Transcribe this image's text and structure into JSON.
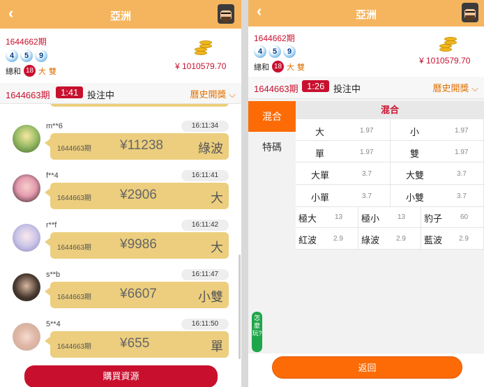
{
  "left": {
    "header": {
      "back_icon": "chevron-left-icon",
      "title": "亞洲",
      "avatar_icon": "user-avatar-icon"
    },
    "draw": {
      "period": "1644662期",
      "balls": [
        "4",
        "5",
        "9"
      ],
      "sum_label": "總和",
      "sum_value": "18",
      "size": "大",
      "parity": "雙",
      "balance": "¥ 1010579.70"
    },
    "current": {
      "period": "1644663期",
      "timer": "1:41",
      "status": "投注中",
      "history": "曆史開獎"
    },
    "messages": [
      {
        "user": "m**6",
        "time": "16:11:34",
        "period": "1644663期",
        "amount": "¥11238",
        "bet": "綠波"
      },
      {
        "user": "f**4",
        "time": "16:11:41",
        "period": "1644663期",
        "amount": "¥2906",
        "bet": "大"
      },
      {
        "user": "r**f",
        "time": "16:11:42",
        "period": "1644663期",
        "amount": "¥9986",
        "bet": "大"
      },
      {
        "user": "s**b",
        "time": "16:11:47",
        "period": "1644663期",
        "amount": "¥6607",
        "bet": "小雙"
      },
      {
        "user": "5**4",
        "time": "16:11:50",
        "period": "1644663期",
        "amount": "¥655",
        "bet": "單"
      }
    ],
    "buy_label": "購買資源"
  },
  "right": {
    "header": {
      "back_icon": "chevron-left-icon",
      "title": "亞洲",
      "avatar_icon": "user-avatar-icon"
    },
    "draw": {
      "period": "1644662期",
      "balls": [
        "4",
        "5",
        "9"
      ],
      "sum_label": "總和",
      "sum_value": "18",
      "size": "大",
      "parity": "雙",
      "balance": "¥ 1010579.70"
    },
    "current": {
      "period": "1644663期",
      "timer": "1:26",
      "status": "投注中",
      "history": "曆史開獎"
    },
    "tabs": [
      "混合",
      "特碼"
    ],
    "section_title": "混合",
    "options_two": [
      {
        "label": "大",
        "odds": "1.97"
      },
      {
        "label": "小",
        "odds": "1.97"
      },
      {
        "label": "單",
        "odds": "1.97"
      },
      {
        "label": "雙",
        "odds": "1.97"
      },
      {
        "label": "大單",
        "odds": "3.7"
      },
      {
        "label": "大雙",
        "odds": "3.7"
      },
      {
        "label": "小單",
        "odds": "3.7"
      },
      {
        "label": "小雙",
        "odds": "3.7"
      }
    ],
    "options_three": [
      {
        "label": "極大",
        "odds": "13"
      },
      {
        "label": "極小",
        "odds": "13"
      },
      {
        "label": "豹子",
        "odds": "60"
      },
      {
        "label": "紅波",
        "odds": "2.9"
      },
      {
        "label": "綠波",
        "odds": "2.9"
      },
      {
        "label": "藍波",
        "odds": "2.9"
      }
    ],
    "help_label": "怎麼玩?",
    "back_label": "返回"
  }
}
